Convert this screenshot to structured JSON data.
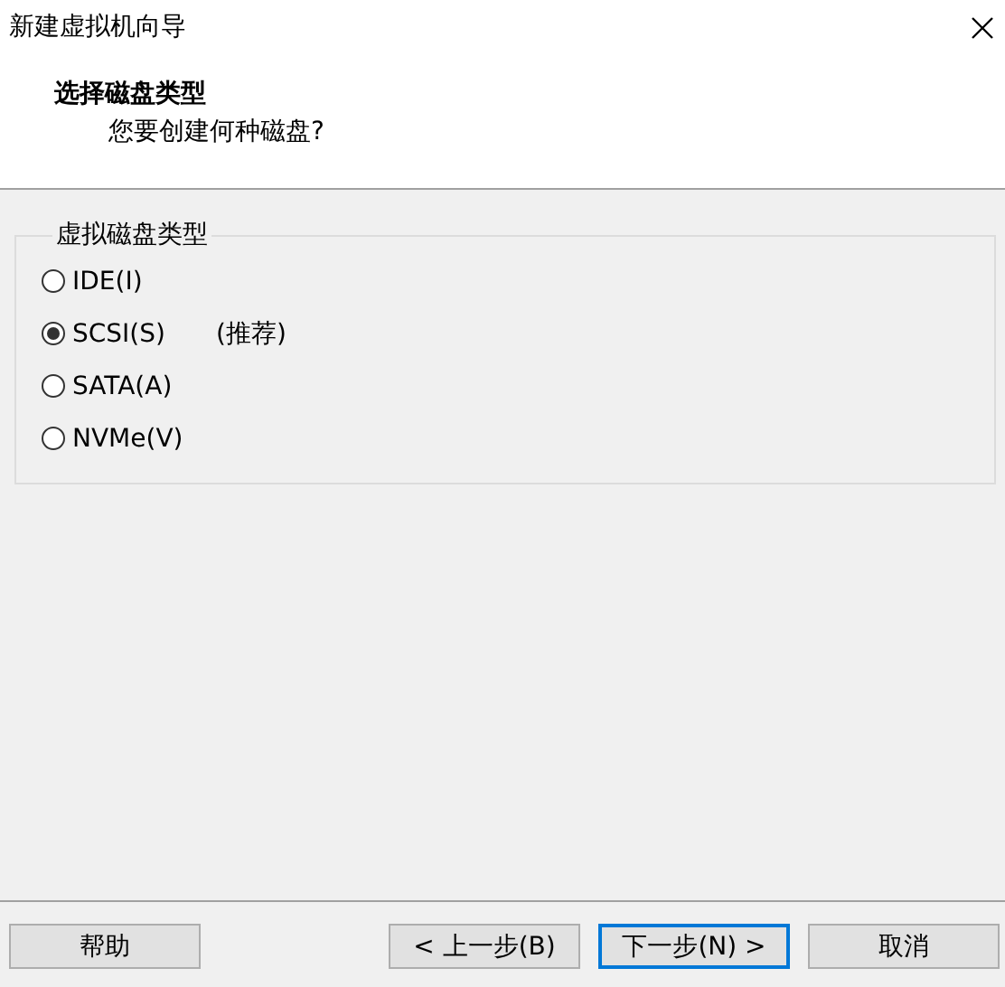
{
  "window": {
    "title": "新建虚拟机向导"
  },
  "header": {
    "title": "选择磁盘类型",
    "subtitle": "您要创建何种磁盘?"
  },
  "disk_type": {
    "label": "虚拟磁盘类型",
    "options": [
      {
        "label": "IDE(I)",
        "selected": false
      },
      {
        "label": "SCSI(S)",
        "selected": true,
        "note": "(推荐)"
      },
      {
        "label": "SATA(A)",
        "selected": false
      },
      {
        "label": "NVMe(V)",
        "selected": false
      }
    ]
  },
  "buttons": [
    {
      "label": "帮助",
      "kind": "normal"
    },
    {
      "label": "< 上一步(B)",
      "kind": "normal"
    },
    {
      "label": "下一步(N) >",
      "kind": "default"
    },
    {
      "label": "取消",
      "kind": "normal"
    }
  ]
}
